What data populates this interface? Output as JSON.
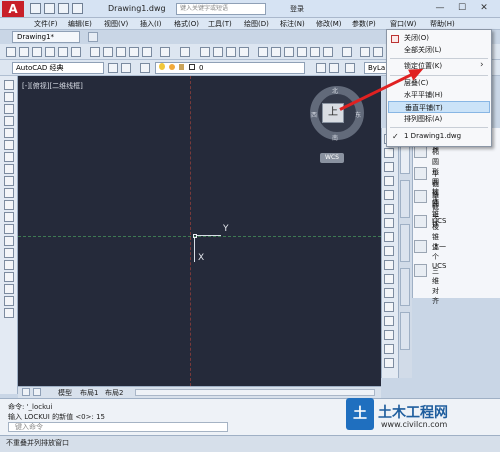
{
  "app": {
    "logo_letter": "A",
    "doc_title": "Drawing1.dwg",
    "search_placeholder": "键入关键字或短语",
    "login": "登录",
    "minimize": "—",
    "restore": "☐",
    "close": "✕"
  },
  "menu": {
    "items": [
      "文件(F)",
      "编辑(E)",
      "视图(V)",
      "插入(I)",
      "格式(O)",
      "工具(T)",
      "绘图(D)",
      "标注(N)",
      "修改(M)",
      "参数(P)",
      "窗口(W)",
      "帮助(H)"
    ]
  },
  "tab": {
    "label": "Drawing1*"
  },
  "toolbar2": {
    "workspace": "AutoCAD 经典",
    "layer": "0",
    "bylayer": "ByLa"
  },
  "viewport": {
    "label": "[-][俯视][二维线框]",
    "cube_text": "上",
    "wcs": "WCS",
    "compass_n": "北",
    "compass_s": "南",
    "compass_w": "西",
    "compass_e": "东",
    "ucs_y": "Y",
    "ucs_x": "X"
  },
  "palette": {
    "items": [
      {
        "label": "楔体",
        "icon": "wedge-icon"
      },
      {
        "label": "椭圆形圆柱体",
        "icon": "elliptic-cylinder-icon"
      },
      {
        "label": "平截面圆锥体",
        "icon": "frustum-cone-icon"
      },
      {
        "label": "平截头棱锥体",
        "icon": "frustum-pyramid-icon"
      },
      {
        "label": "UCS",
        "icon": "ucs-icon"
      },
      {
        "label": "上一个 UCS",
        "icon": "previous-ucs-icon"
      },
      {
        "label": "三维对齐",
        "icon": "3d-align-icon"
      }
    ]
  },
  "layout_tabs": {
    "model": "模型",
    "layout1": "布局1",
    "layout2": "布局2"
  },
  "command": {
    "line1": "命令: '_lockui",
    "line2": "输入 LOCKUI 的新值 <0>: 15",
    "placeholder": "键入命令"
  },
  "status": {
    "text": "不重叠并列排放窗口"
  },
  "window_menu": {
    "items": [
      "关闭(O)",
      "全部关闭(L)",
      "锁定位置(K)",
      "层叠(C)",
      "水平平铺(H)",
      "垂直平铺(T)",
      "排列图标(A)",
      "1 Drawing1.dwg"
    ],
    "submenu_arrow": "›",
    "selected": "垂直平铺(T)",
    "checked": "1 Drawing1.dwg",
    "check_mark": "✓"
  },
  "watermark": {
    "brand": "土木工程网",
    "url": "www.civilcn.com",
    "logo_text": "土"
  },
  "colors": {
    "canvas": "#252a3a",
    "arrow": "#e02121",
    "highlight": "#cbe3f8",
    "logo_red": "#c8202a"
  }
}
